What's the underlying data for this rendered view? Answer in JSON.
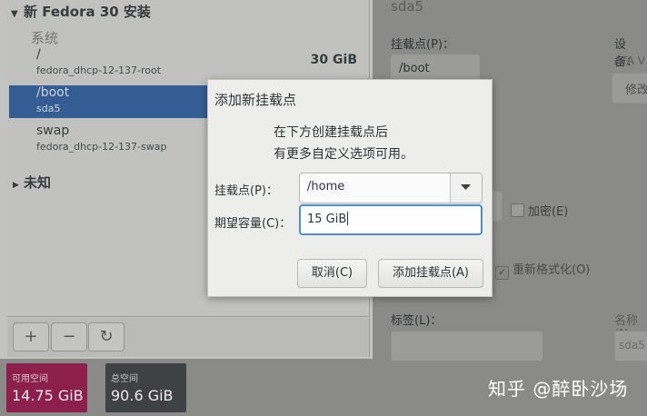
{
  "tree": {
    "header": "新 Fedora 30 安装",
    "group": "系统",
    "partitions": [
      {
        "name": "/",
        "device": "fedora_dhcp-12-137-root",
        "size": "30 GiB"
      },
      {
        "name": "/boot",
        "device": "sda5",
        "size": ""
      },
      {
        "name": "swap",
        "device": "fedora_dhcp-12-137-swap",
        "size": ""
      }
    ],
    "unknown": "未知"
  },
  "toolbar": {
    "add_icon": "+",
    "remove_icon": "−",
    "refresh_icon": "↻"
  },
  "space": {
    "available_label": "可用空间",
    "available_value": "14.75 GiB",
    "total_label": "总空间",
    "total_value": "90.6 GiB"
  },
  "details": {
    "partition": "sda5",
    "mount_point_label": "挂载点(P)：",
    "mount_point_value": "/boot",
    "device_label": "设备：",
    "device_value": "ATA V",
    "modify_label": "修改",
    "encrypt_label": "加密(E)",
    "reformat_label": "重新格式化(O)",
    "label_label": "标签(L)：",
    "name_label": "名称(N",
    "name_value": "sda5"
  },
  "dialog": {
    "title": "添加新挂载点",
    "message_line1": "在下方创建挂载点后",
    "message_line2": "有更多自定义选项可用。",
    "mount_label": "挂载点(P)：",
    "mount_value": "/home",
    "capacity_label": "期望容量(C)：",
    "capacity_value": "15 GiB",
    "cancel_label": "取消(C)",
    "add_label": "添加挂载点(A)"
  },
  "watermark": "知乎 @醉卧沙场",
  "colors": {
    "selection": "#2a5ea0",
    "available_space": "#8c1f4c",
    "total_space": "#3f4244",
    "focus_ring": "#4a90d9"
  }
}
